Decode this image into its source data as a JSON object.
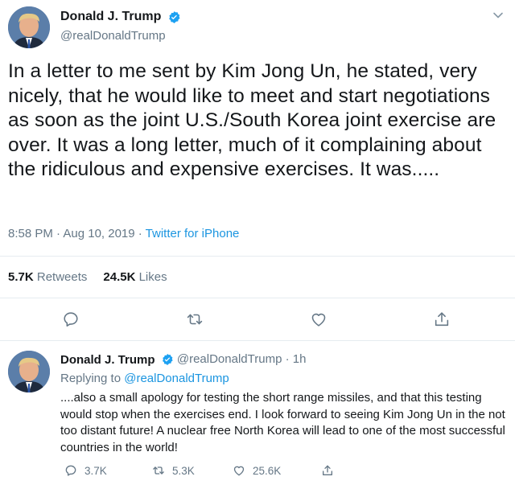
{
  "main_tweet": {
    "author_name": "Donald J. Trump",
    "handle": "@realDonaldTrump",
    "text": "In a letter to me sent by Kim Jong Un, he stated, very nicely, that he would like to meet and start negotiations as soon as the joint U.S./South Korea joint exercise are over. It was a long letter, much of it complaining about the ridiculous and expensive exercises. It was.....",
    "time": "8:58 PM · Aug 10, 2019 · ",
    "source": "Twitter for iPhone",
    "retweets_count": "5.7K",
    "retweets_label": "Retweets",
    "likes_count": "24.5K",
    "likes_label": "Likes"
  },
  "reply_tweet": {
    "author_name": "Donald J. Trump",
    "handle": "@realDonaldTrump",
    "separator": " · ",
    "time": "1h",
    "replying_label": "Replying to ",
    "replying_to": "@realDonaldTrump",
    "text": "....also a small apology for testing the short range missiles, and that this testing would stop when the exercises end. I look forward to seeing Kim Jong Un in the not too distant future! A nuclear free North Korea will lead to one of the most successful countries in the world!",
    "replies_count": "3.7K",
    "retweets_count": "5.3K",
    "likes_count": "25.6K"
  },
  "colors": {
    "accent": "#1b95e0",
    "muted": "#657786",
    "text": "#14171a",
    "divider": "#e6ecf0"
  },
  "icons": [
    "verified-badge-icon",
    "chevron-down-icon",
    "reply-icon",
    "retweet-icon",
    "like-icon",
    "share-icon"
  ]
}
